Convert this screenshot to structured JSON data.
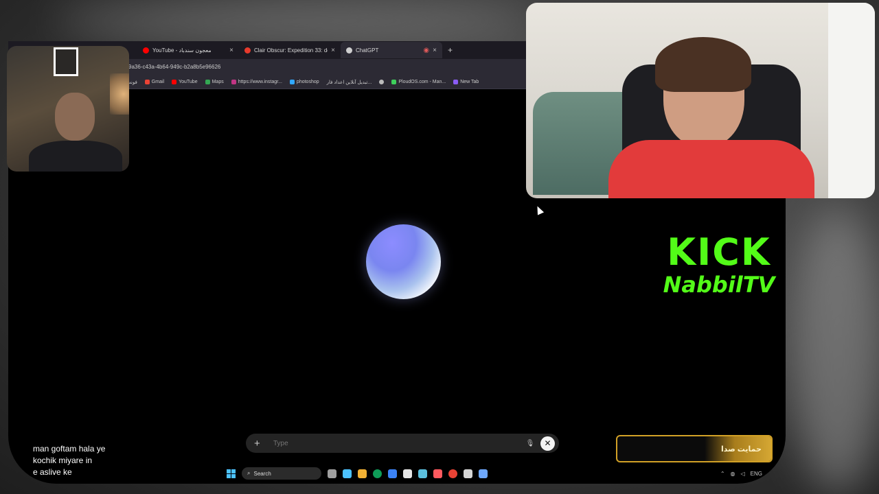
{
  "browser": {
    "tabs": [
      {
        "title": "YouTube - معجون سندباد",
        "favicon_color": "#ff0000",
        "active": false
      },
      {
        "title": "Clair Obscur: Expedition 33: de",
        "favicon_color": "#e83a2c",
        "active": false
      },
      {
        "title": "ChatGPT",
        "favicon_color": "#cfcfcf",
        "active": true
      }
    ],
    "new_tab_glyph": "+",
    "address": "9a36-c43a-4b64-949c-b2a8b5e96626",
    "bookmarks": [
      {
        "label": "فونت",
        "color": "#e8833a"
      },
      {
        "label": "Gmail",
        "color": "#ea4335"
      },
      {
        "label": "YouTube",
        "color": "#ff0000"
      },
      {
        "label": "Maps",
        "color": "#34a853"
      },
      {
        "label": "https://www.instagr...",
        "color": "#c13584"
      },
      {
        "label": "photoshop",
        "color": "#31a8ff"
      },
      {
        "label": "تبدیل آنلاین اعداد فار...",
        "color": "#888888"
      },
      {
        "label": "",
        "color": "#bbbbbb"
      },
      {
        "label": "PloudOS.com - Man...",
        "color": "#3ecf5b"
      },
      {
        "label": "New Tab",
        "color": "#8b5cf6"
      }
    ]
  },
  "chatgpt": {
    "input_placeholder": "Type",
    "add_glyph": "+",
    "mic_glyph": "🎙",
    "close_glyph": "✕"
  },
  "taskbar": {
    "search_label": "Search",
    "app_colors": [
      "#a0a0a0",
      "#4cc2ff",
      "#f2b134",
      "#0f9d58",
      "#3b82f6",
      "#e5e5e5",
      "#5bc0de",
      "#ff5a5f",
      "#ea4335",
      "#d6d6d6",
      "#6ea8fe"
    ],
    "tray_lang": "ENG"
  },
  "overlay": {
    "kick_word": "KICK",
    "channel": "NabbilTV",
    "donate_label": "حمایت صدا",
    "chat_lines": [
      "man goftam hala ye",
      "kochik miyare in",
      "e aslive ke"
    ]
  }
}
